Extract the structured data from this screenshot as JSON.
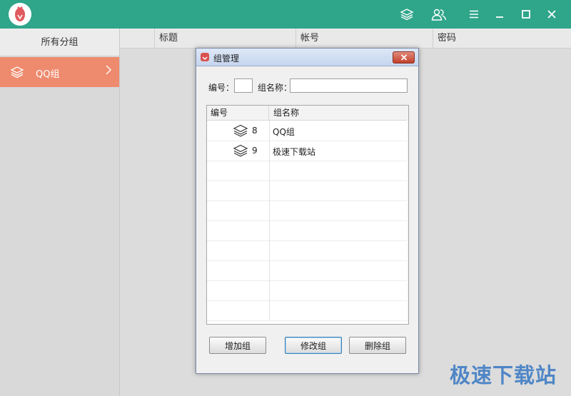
{
  "window": {
    "titlebar_color": "#2fa58a",
    "icons": [
      "layers-icon",
      "users-icon",
      "menu-icon",
      "minimize-icon",
      "maximize-icon",
      "close-icon"
    ]
  },
  "sidebar": {
    "header": "所有分组",
    "items": [
      {
        "label": "QQ组",
        "icon": "layers-icon",
        "selected": true,
        "color": "#ee8a6d"
      }
    ]
  },
  "table": {
    "columns": [
      "标题",
      "帐号",
      "密码"
    ]
  },
  "dialog": {
    "title": "组管理",
    "id_label": "编号：",
    "id_value": "",
    "name_label": "组名称：",
    "name_value": "",
    "list": {
      "headers": [
        "编号",
        "组名称"
      ],
      "rows": [
        {
          "id": "8",
          "name": "QQ组"
        },
        {
          "id": "9",
          "name": "极速下载站"
        }
      ]
    },
    "buttons": {
      "add": "增加组",
      "edit": "修改组",
      "delete": "删除组"
    }
  },
  "watermark": "极速下载站"
}
